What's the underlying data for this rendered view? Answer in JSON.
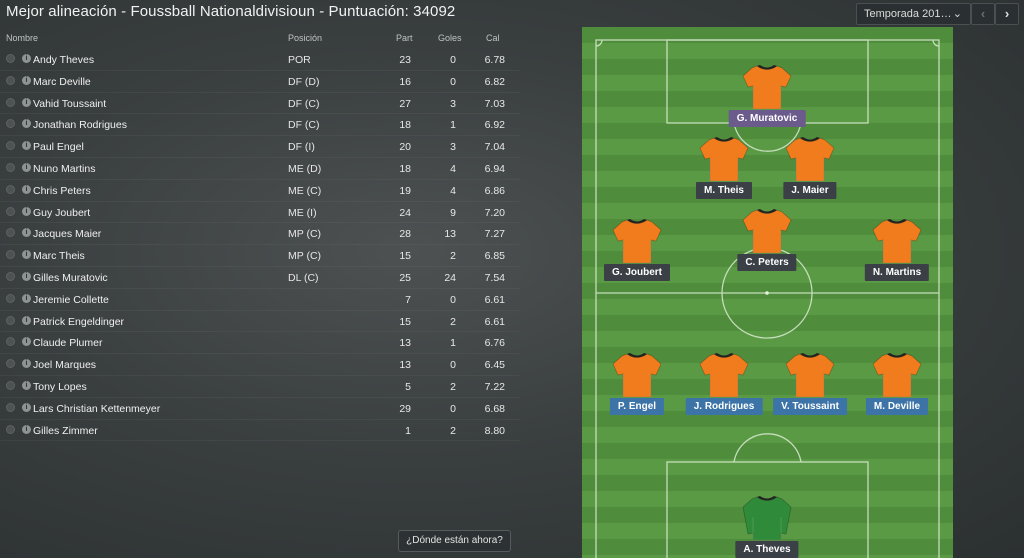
{
  "title": "Mejor alineación - Foussball Nationaldivisioun - Puntuación: 34092",
  "season": {
    "label": "Temporada 201…",
    "chevron": "⌄"
  },
  "nav": {
    "prev": "‹",
    "next": "›"
  },
  "table": {
    "headers": {
      "name": "Nombre",
      "position": "Posición",
      "apps": "Part",
      "goals": "Goles",
      "rating": "Cal"
    },
    "rows": [
      {
        "name": "Andy Theves",
        "position": "POR",
        "apps": "23",
        "goals": "0",
        "rating": "6.78"
      },
      {
        "name": "Marc Deville",
        "position": "DF (D)",
        "apps": "16",
        "goals": "0",
        "rating": "6.82"
      },
      {
        "name": "Vahid Toussaint",
        "position": "DF (C)",
        "apps": "27",
        "goals": "3",
        "rating": "7.03"
      },
      {
        "name": "Jonathan Rodrigues",
        "position": "DF (C)",
        "apps": "18",
        "goals": "1",
        "rating": "6.92"
      },
      {
        "name": "Paul Engel",
        "position": "DF (I)",
        "apps": "20",
        "goals": "3",
        "rating": "7.04"
      },
      {
        "name": "Nuno Martins",
        "position": "ME (D)",
        "apps": "18",
        "goals": "4",
        "rating": "6.94"
      },
      {
        "name": "Chris Peters",
        "position": "ME (C)",
        "apps": "19",
        "goals": "4",
        "rating": "6.86"
      },
      {
        "name": "Guy Joubert",
        "position": "ME (I)",
        "apps": "24",
        "goals": "9",
        "rating": "7.20"
      },
      {
        "name": "Jacques Maier",
        "position": "MP (C)",
        "apps": "28",
        "goals": "13",
        "rating": "7.27"
      },
      {
        "name": "Marc Theis",
        "position": "MP (C)",
        "apps": "15",
        "goals": "2",
        "rating": "6.85"
      },
      {
        "name": "Gilles Muratovic",
        "position": "DL (C)",
        "apps": "25",
        "goals": "24",
        "rating": "7.54"
      },
      {
        "name": "Jeremie Collette",
        "position": "",
        "apps": "7",
        "goals": "0",
        "rating": "6.61"
      },
      {
        "name": "Patrick Engeldinger",
        "position": "",
        "apps": "15",
        "goals": "2",
        "rating": "6.61"
      },
      {
        "name": "Claude Plumer",
        "position": "",
        "apps": "13",
        "goals": "1",
        "rating": "6.76"
      },
      {
        "name": "Joel Marques",
        "position": "",
        "apps": "13",
        "goals": "0",
        "rating": "6.45"
      },
      {
        "name": "Tony Lopes",
        "position": "",
        "apps": "5",
        "goals": "2",
        "rating": "7.22"
      },
      {
        "name": "Lars Christian Kettenmeyer",
        "position": "",
        "apps": "29",
        "goals": "0",
        "rating": "6.68"
      },
      {
        "name": "Gilles Zimmer",
        "position": "",
        "apps": "1",
        "goals": "2",
        "rating": "8.80"
      }
    ]
  },
  "where_button": "¿Dónde están ahora?",
  "pitch": {
    "players": [
      {
        "label": "G. Muratovic",
        "kit": "outfield",
        "style": "gk"
      },
      {
        "label": "M. Theis",
        "kit": "outfield",
        "style": "dark"
      },
      {
        "label": "J. Maier",
        "kit": "outfield",
        "style": "dark"
      },
      {
        "label": "G. Joubert",
        "kit": "outfield",
        "style": "dark"
      },
      {
        "label": "C. Peters",
        "kit": "outfield",
        "style": "dark"
      },
      {
        "label": "N. Martins",
        "kit": "outfield",
        "style": "dark"
      },
      {
        "label": "P. Engel",
        "kit": "outfield",
        "style": "def"
      },
      {
        "label": "J. Rodrigues",
        "kit": "outfield",
        "style": "def"
      },
      {
        "label": "V. Toussaint",
        "kit": "outfield",
        "style": "def"
      },
      {
        "label": "M. Deville",
        "kit": "outfield",
        "style": "def"
      },
      {
        "label": "A. Theves",
        "kit": "keeper",
        "style": "gk2"
      }
    ]
  },
  "colors": {
    "kit_outfield": "#f07c1e",
    "kit_keeper": "#2f8a3a",
    "pitch_dark": "#4f8c3c",
    "pitch_light": "#5a9a45"
  }
}
